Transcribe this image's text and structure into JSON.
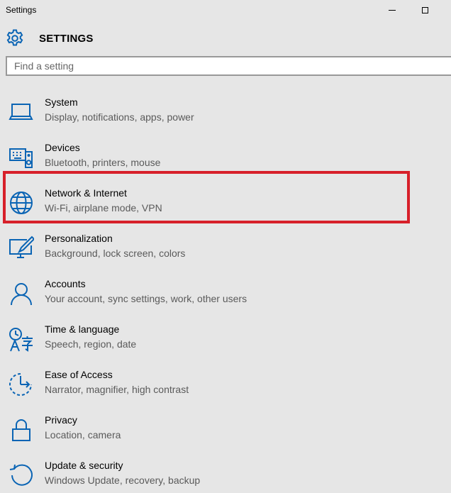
{
  "window": {
    "title": "Settings",
    "accent_color": "#0a64b4",
    "highlight_color": "#d7202a"
  },
  "header": {
    "icon": "gear-icon",
    "title": "SETTINGS"
  },
  "search": {
    "placeholder": "Find a setting",
    "value": ""
  },
  "items": [
    {
      "icon": "laptop-icon",
      "title": "System",
      "subtitle": "Display, notifications, apps, power"
    },
    {
      "icon": "keyboard-speaker-icon",
      "title": "Devices",
      "subtitle": "Bluetooth, printers, mouse"
    },
    {
      "icon": "globe-icon",
      "title": "Network & Internet",
      "subtitle": "Wi-Fi, airplane mode, VPN",
      "highlighted": true
    },
    {
      "icon": "monitor-pen-icon",
      "title": "Personalization",
      "subtitle": "Background, lock screen, colors"
    },
    {
      "icon": "person-icon",
      "title": "Accounts",
      "subtitle": "Your account, sync settings, work, other users"
    },
    {
      "icon": "language-icon",
      "title": "Time & language",
      "subtitle": "Speech, region, date"
    },
    {
      "icon": "ease-of-access-icon",
      "title": "Ease of Access",
      "subtitle": "Narrator, magnifier, high contrast"
    },
    {
      "icon": "lock-icon",
      "title": "Privacy",
      "subtitle": "Location, camera"
    },
    {
      "icon": "refresh-icon",
      "title": "Update & security",
      "subtitle": "Windows Update, recovery, backup"
    }
  ]
}
